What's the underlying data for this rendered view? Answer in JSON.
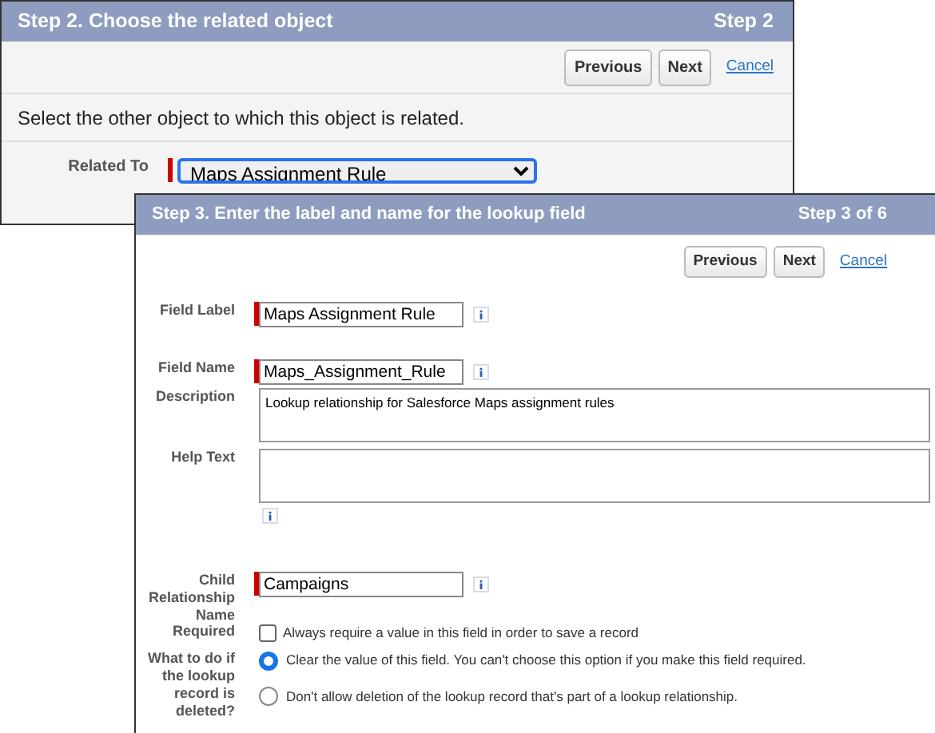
{
  "back_panel": {
    "title": "Step 2. Choose the related object",
    "step": "Step 2",
    "buttons": [
      "Previous",
      "Next"
    ],
    "cancel": "Cancel",
    "instruction": "Select the other object to which this object is related.",
    "related_to": {
      "label": "Related To",
      "value": "Maps Assignment Rule",
      "required": true
    }
  },
  "front_panel": {
    "title": "Step 3. Enter the label and name for the lookup field",
    "step": "Step 3 of 6",
    "buttons": [
      "Previous",
      "Next"
    ],
    "cancel": "Cancel",
    "fields": [
      {
        "kind": "text",
        "label": "Field Label",
        "value": "Maps Assignment Rule",
        "required": true,
        "info": true
      },
      {
        "kind": "text",
        "label": "Field Name",
        "value": "Maps_Assignment_Rule",
        "required": true,
        "info": true
      },
      {
        "kind": "textarea",
        "label": "Description",
        "value": "Lookup relationship for Salesforce Maps assignment rules"
      },
      {
        "kind": "textarea",
        "label": "Help Text",
        "info": true
      },
      {
        "kind": "text",
        "label": "Child Relationship Name",
        "value": "Campaigns",
        "required": true,
        "info": true
      },
      {
        "kind": "checkbox",
        "label": "Required",
        "text": "Always require a value in this field in order to save a record",
        "checked": false
      },
      {
        "kind": "radio",
        "label": "What to do if the lookup record is deleted?",
        "options": [
          {
            "text": "Clear the value of this field. You can't choose this option if you make this field required.",
            "selected": true
          },
          {
            "text": "Don't allow deletion of the lookup record that's part of a lookup relationship.",
            "selected": false
          }
        ]
      }
    ]
  }
}
